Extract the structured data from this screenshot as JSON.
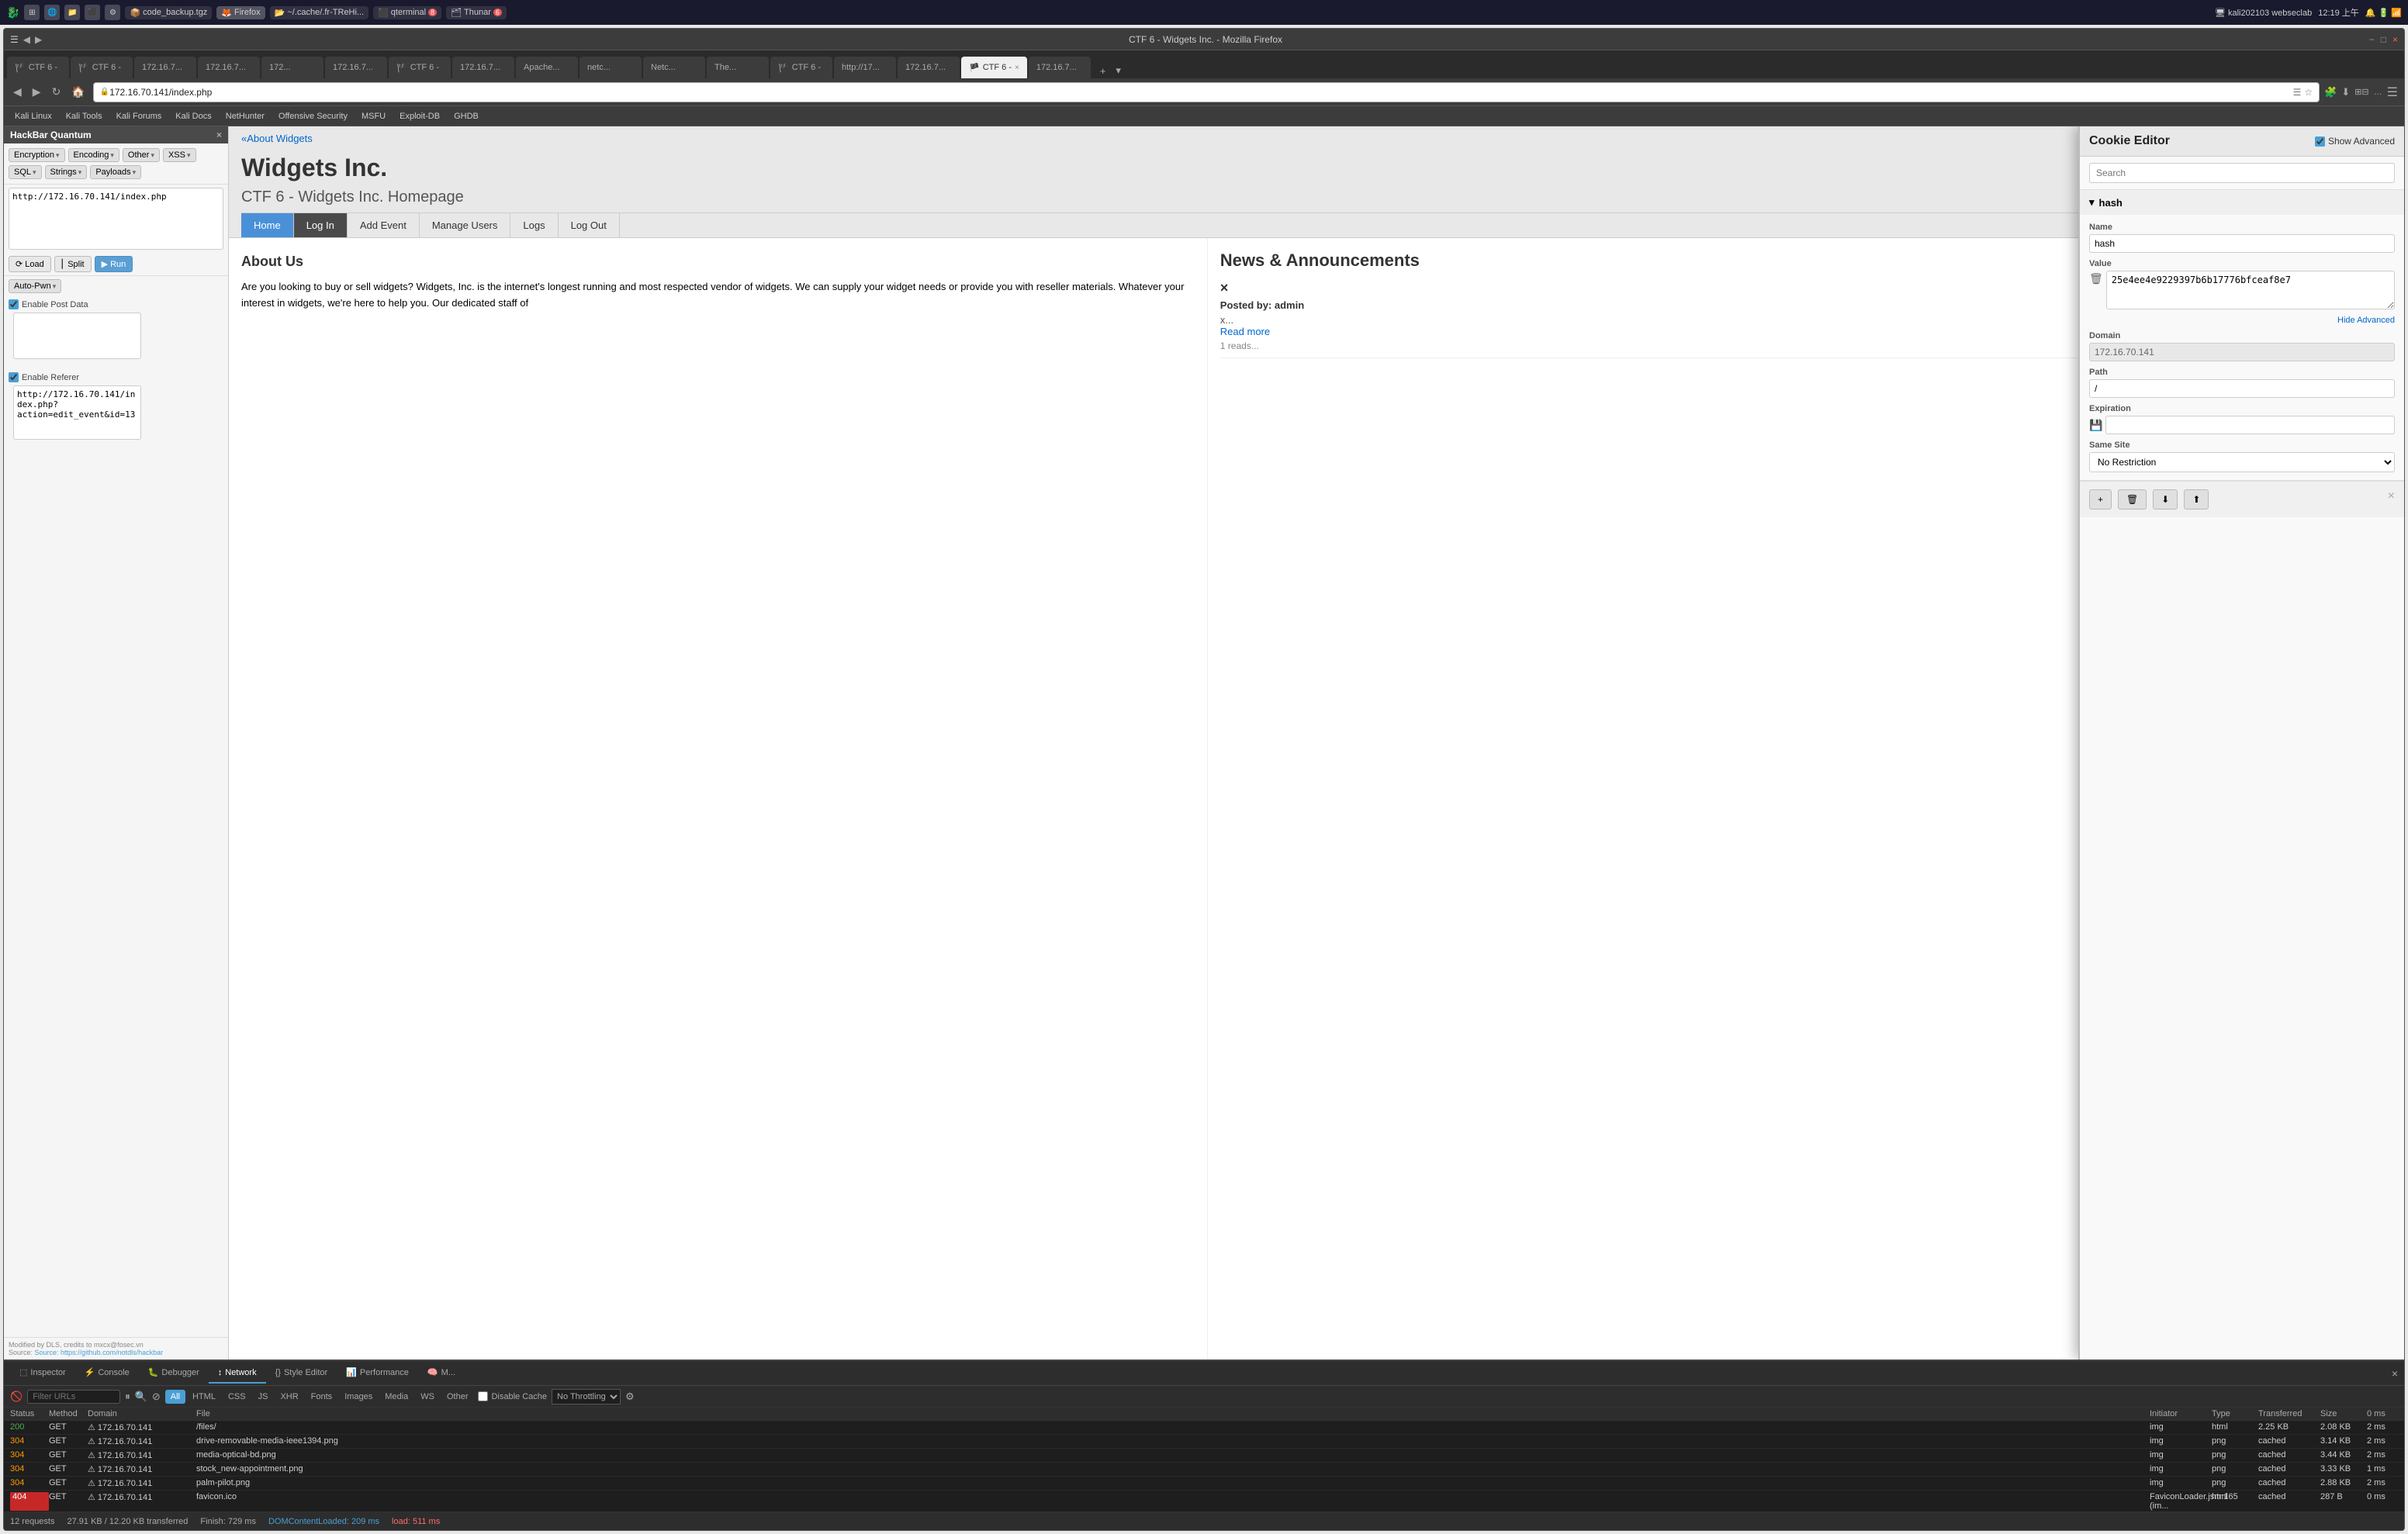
{
  "os": {
    "topbar": {
      "app_title": "CTF 6 - Widgets Inc. - Mozilla Firefox",
      "controls": [
        "−",
        "□",
        "×"
      ]
    },
    "taskbar": {
      "items": [
        {
          "label": "code_backup.tgz",
          "icon": "file-icon"
        },
        {
          "label": "Firefox",
          "icon": "firefox-icon",
          "active": true
        },
        {
          "label": "~/.cache/.fr-TReHi...",
          "icon": "folder-icon"
        },
        {
          "label": "qterminal",
          "icon": "terminal-icon",
          "badge": "8"
        },
        {
          "label": "Thunar",
          "icon": "thunar-icon",
          "badge": "6"
        }
      ],
      "clock": "12:19 上午",
      "kali_label": "Kali Linux"
    }
  },
  "firefox": {
    "tabs": [
      {
        "label": "CTF 6 -",
        "active": false
      },
      {
        "label": "CTF 6 -",
        "active": false
      },
      {
        "label": "172.16.7...",
        "active": false
      },
      {
        "label": "172.16.7...",
        "active": false
      },
      {
        "label": "172...",
        "active": false
      },
      {
        "label": "172.16.7...",
        "active": false
      },
      {
        "label": "CTF 6 -",
        "active": false
      },
      {
        "label": "172.16.7...",
        "active": false
      },
      {
        "label": "Apache...",
        "active": false
      },
      {
        "label": "netc...",
        "active": false
      },
      {
        "label": "Netc...",
        "active": false
      },
      {
        "label": "The...",
        "active": false
      },
      {
        "label": "CTF 6 -",
        "active": false
      },
      {
        "label": "http://17...",
        "active": false
      },
      {
        "label": "172.16.7...",
        "active": false
      },
      {
        "label": "CTF 6 -",
        "active": true
      },
      {
        "label": "172.16.7...",
        "active": false
      }
    ],
    "url": "172.16.70.141/index.php",
    "bookmarks": [
      "Kali Linux",
      "Kali Tools",
      "Kali Forums",
      "Kali Docs",
      "NetHunter",
      "Offensive Security",
      "MSFU",
      "Exploit-DB",
      "GHDB"
    ]
  },
  "hackbar": {
    "title": "HackBar Quantum",
    "buttons": {
      "encryption": "Encryption",
      "encoding": "Encoding",
      "other": "Other",
      "xss": "XSS",
      "sql": "SQL",
      "strings": "Strings",
      "payloads": "Payloads"
    },
    "actions": {
      "load": "Load",
      "split": "Split",
      "run": "Run"
    },
    "textarea_value": "http://172.16.70.141/index.php",
    "autopwn": {
      "label": "Auto-Pwn",
      "enable_post": "Enable Post Data"
    },
    "enable_referer": "Enable Referer",
    "referer_value": "http://172.16.70.141/index.php?action=edit_event&id=13",
    "footer": {
      "modified_by": "Modified by DLS, credits to mxcx@fosec.vn",
      "source": "Source: https://github.com/notdls/hackbar"
    }
  },
  "website": {
    "breadcrumb": "«About Widgets",
    "title": "Widgets Inc.",
    "subtitle": "CTF 6 - Widgets Inc. Homepage",
    "nav": [
      {
        "label": "Home",
        "style": "home"
      },
      {
        "label": "Log In",
        "style": "active"
      },
      {
        "label": "Add Event"
      },
      {
        "label": "Manage Users"
      },
      {
        "label": "Logs"
      },
      {
        "label": "Log Out"
      }
    ],
    "about": {
      "heading": "About Us",
      "text": "Are you looking to buy or sell widgets? Widgets, Inc. is the internet's longest running and most respected vendor of widgets. We can supply your widget needs or provide you with reseller materials. Whatever your interest in widgets, we're here to help you. Our dedicated staff of"
    },
    "news": {
      "heading": "News & Announcements",
      "posts": [
        {
          "icon": "×",
          "posted_by": "Posted by: admin",
          "content": "x...",
          "read_more": "Read more",
          "reads": "1 reads..."
        }
      ]
    }
  },
  "cookie_editor": {
    "title": "Cookie Editor",
    "show_advanced": "Show Advanced",
    "search_placeholder": "Search",
    "cookie_name": "hash",
    "fields": {
      "name_label": "Name",
      "name_value": "hash",
      "value_label": "Value",
      "value_value": "25e4ee4e9229397b6b17776bfceaf8e7",
      "domain_label": "Domain",
      "domain_value": "172.16.70.141",
      "path_label": "Path",
      "path_value": "/",
      "expiration_label": "Expiration",
      "expiration_value": "",
      "same_site_label": "Same Site",
      "same_site_value": "No Restriction"
    },
    "hide_advanced": "Hide Advanced",
    "actions": {
      "add": "+",
      "delete": "🗑",
      "import": "⬇",
      "export": "⬆"
    }
  },
  "devtools": {
    "tabs": [
      {
        "label": "Inspector",
        "icon": "inspector-icon"
      },
      {
        "label": "Console",
        "icon": "console-icon"
      },
      {
        "label": "Debugger",
        "icon": "debugger-icon"
      },
      {
        "label": "Network",
        "icon": "network-icon",
        "active": true
      },
      {
        "label": "Style Editor",
        "icon": "style-icon"
      },
      {
        "label": "Performance",
        "icon": "perf-icon"
      },
      {
        "label": "M...",
        "icon": "mem-icon"
      }
    ],
    "filter_placeholder": "Filter URLs",
    "type_buttons": [
      "All",
      "HTML",
      "CSS",
      "JS",
      "XHR",
      "Fonts",
      "Images",
      "Media",
      "WS",
      "Other"
    ],
    "active_type": "All",
    "disable_cache": "Disable Cache",
    "throttle": "No Throttling",
    "columns": [
      "Status",
      "Method",
      "Domain",
      "File",
      "Initiator",
      "Type",
      "Transferred",
      "Size",
      ""
    ],
    "rows": [
      {
        "status": "200",
        "method": "GET",
        "domain": "172.16.70.141",
        "file": "/files/",
        "initiator": "img",
        "type": "html",
        "transferred": "2.25 KB",
        "size": "2.08 KB",
        "time": "2 ms",
        "status_class": "status-200"
      },
      {
        "status": "304",
        "method": "GET",
        "domain": "172.16.70.141",
        "file": "drive-removable-media-ieee1394.png",
        "initiator": "img",
        "type": "png",
        "transferred": "cached",
        "size": "3.14 KB",
        "time": "2 ms",
        "status_class": "status-304"
      },
      {
        "status": "304",
        "method": "GET",
        "domain": "172.16.70.141",
        "file": "media-optical-bd.png",
        "initiator": "img",
        "type": "png",
        "transferred": "cached",
        "size": "3.44 KB",
        "time": "2 ms",
        "status_class": "status-304"
      },
      {
        "status": "304",
        "method": "GET",
        "domain": "172.16.70.141",
        "file": "stock_new-appointment.png",
        "initiator": "img",
        "type": "png",
        "transferred": "cached",
        "size": "3.33 KB",
        "time": "1 ms",
        "status_class": "status-304"
      },
      {
        "status": "304",
        "method": "GET",
        "domain": "172.16.70.141",
        "file": "palm-pilot.png",
        "initiator": "img",
        "type": "png",
        "transferred": "cached",
        "size": "2.88 KB",
        "time": "2 ms",
        "status_class": "status-304"
      },
      {
        "status": "404",
        "method": "GET",
        "domain": "172.16.70.141",
        "file": "favicon.ico",
        "initiator": "FaviconLoader.jsm:165 (im...",
        "type": "html",
        "transferred": "cached",
        "size": "287 B",
        "time": "0 ms",
        "status_class": "status-404"
      }
    ],
    "footer": {
      "requests": "12 requests",
      "transferred": "27.91 KB / 12.20 KB transferred",
      "finish": "Finish: 729 ms",
      "dom_loaded": "DOMContentLoaded: 209 ms",
      "load": "load: 511 ms"
    }
  }
}
